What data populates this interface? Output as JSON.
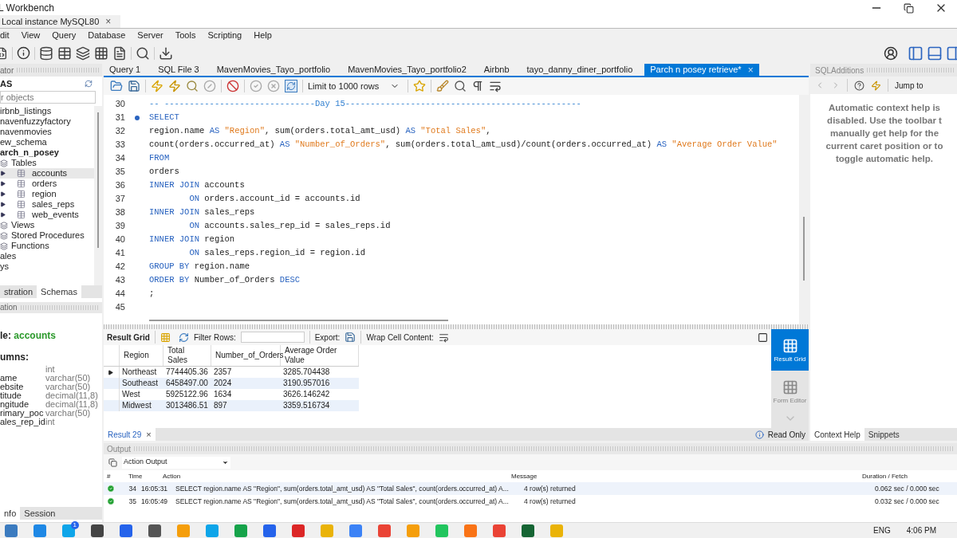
{
  "window": {
    "title": "L Workbench"
  },
  "connection_tab": {
    "label": "Local instance MySQL80",
    "close": "×"
  },
  "menu": [
    "dit",
    "View",
    "Query",
    "Database",
    "Server",
    "Tools",
    "Scripting",
    "Help"
  ],
  "navigator": {
    "header": "ator",
    "schemas_label": "AS",
    "search": {
      "placeholder": "r objects"
    },
    "schemas": [
      {
        "label": "irbnb_listings",
        "active": false
      },
      {
        "label": "navenfuzzyfactory",
        "active": false
      },
      {
        "label": "navenmovies",
        "active": false
      },
      {
        "label": "ew_schema",
        "active": false
      },
      {
        "label": "arch_n_posey",
        "active": true,
        "children": [
          {
            "label": "Tables",
            "children": [
              {
                "label": "accounts",
                "selected": true
              },
              {
                "label": "orders",
                "selected": false
              },
              {
                "label": "region",
                "selected": false
              },
              {
                "label": "sales_reps",
                "selected": false
              },
              {
                "label": "web_events",
                "selected": false
              }
            ]
          },
          {
            "label": "Views"
          },
          {
            "label": "Stored Procedures"
          },
          {
            "label": "Functions"
          }
        ]
      },
      {
        "label": "ales",
        "active": false
      },
      {
        "label": "ys",
        "active": false
      }
    ],
    "tabs": [
      {
        "label": "stration",
        "selected": false
      },
      {
        "label": "Schemas",
        "selected": true
      }
    ]
  },
  "information": {
    "header": "ation",
    "title_prefix": "le: ",
    "title_value": "accounts",
    "columns_label": "umns:",
    "columns": [
      {
        "type": "int"
      },
      {
        "name": "ame",
        "type": "varchar(50)"
      },
      {
        "name": "ebsite",
        "type": "varchar(50)"
      },
      {
        "name": "titude",
        "type": "decimal(11,8)"
      },
      {
        "name": "ngitude",
        "type": "decimal(11,8)"
      },
      {
        "name": "rimary_poc",
        "type": "varchar(50)"
      },
      {
        "name": "ales_rep_id",
        "type": "int"
      }
    ],
    "tabs": [
      {
        "label": "nfo",
        "selected": true
      },
      {
        "label": "Session",
        "selected": false
      }
    ]
  },
  "query_tabs": [
    {
      "label": "Query 1",
      "selected": false
    },
    {
      "label": "SQL File 3",
      "selected": false
    },
    {
      "label": "MavenMovies_Tayo_portfolio",
      "selected": false
    },
    {
      "label": "MavenMovies_Tayo_portfolio2",
      "selected": false
    },
    {
      "label": "Airbnb",
      "selected": false
    },
    {
      "label": "tayo_danny_diner_portfolio",
      "selected": false
    },
    {
      "label": "Parch n posey retrieve*",
      "selected": true,
      "close": "×"
    }
  ],
  "editor": {
    "limit": "Limit to 1000 rows",
    "lines": [
      {
        "number": "30",
        "current": false,
        "segments": [
          {
            "kind": "comment",
            "text": "-- ------------------------------Day 15-----------------------------------------------"
          }
        ]
      },
      {
        "number": "31",
        "current": true,
        "segments": [
          {
            "kind": "keyword",
            "text": "SELECT"
          }
        ]
      },
      {
        "number": "32",
        "current": false,
        "segments": [
          {
            "kind": "plain",
            "text": "region.name "
          },
          {
            "kind": "keyword",
            "text": "AS"
          },
          {
            "kind": "string",
            "text": " \"Region\""
          },
          {
            "kind": "plain",
            "text": ", sum(orders.total_amt_usd) "
          },
          {
            "kind": "keyword",
            "text": "AS"
          },
          {
            "kind": "string",
            "text": " \"Total Sales\""
          },
          {
            "kind": "plain",
            "text": ","
          }
        ]
      },
      {
        "number": "33",
        "current": false,
        "segments": [
          {
            "kind": "plain",
            "text": "count(orders.occurred_at) "
          },
          {
            "kind": "keyword",
            "text": "AS"
          },
          {
            "kind": "string",
            "text": " \"Number_of_Orders\""
          },
          {
            "kind": "plain",
            "text": ", sum(orders.total_amt_usd)/count(orders.occurred_at) "
          },
          {
            "kind": "keyword",
            "text": "AS"
          },
          {
            "kind": "string",
            "text": " \"Average Order Value\""
          }
        ]
      },
      {
        "number": "34",
        "current": false,
        "segments": [
          {
            "kind": "keyword",
            "text": "FROM"
          }
        ]
      },
      {
        "number": "35",
        "current": false,
        "segments": [
          {
            "kind": "plain",
            "text": "orders"
          }
        ]
      },
      {
        "number": "36",
        "current": false,
        "segments": [
          {
            "kind": "keyword",
            "text": "INNER JOIN"
          },
          {
            "kind": "plain",
            "text": " accounts"
          }
        ]
      },
      {
        "number": "37",
        "current": false,
        "segments": [
          {
            "kind": "keyword",
            "text": "        ON"
          },
          {
            "kind": "plain",
            "text": " orders.account_id = accounts.id"
          }
        ]
      },
      {
        "number": "38",
        "current": false,
        "segments": [
          {
            "kind": "keyword",
            "text": "INNER JOIN"
          },
          {
            "kind": "plain",
            "text": " sales_reps"
          }
        ]
      },
      {
        "number": "39",
        "current": false,
        "segments": [
          {
            "kind": "keyword",
            "text": "        ON"
          },
          {
            "kind": "plain",
            "text": " accounts.sales_rep_id = sales_reps.id"
          }
        ]
      },
      {
        "number": "40",
        "current": false,
        "segments": [
          {
            "kind": "keyword",
            "text": "INNER JOIN"
          },
          {
            "kind": "plain",
            "text": " region"
          }
        ]
      },
      {
        "number": "41",
        "current": false,
        "segments": [
          {
            "kind": "keyword",
            "text": "        ON"
          },
          {
            "kind": "plain",
            "text": " sales_reps.region_id = region.id"
          }
        ]
      },
      {
        "number": "42",
        "current": false,
        "segments": [
          {
            "kind": "keyword",
            "text": "GROUP BY"
          },
          {
            "kind": "plain",
            "text": " region.name"
          }
        ]
      },
      {
        "number": "43",
        "current": false,
        "segments": [
          {
            "kind": "keyword",
            "text": "ORDER BY"
          },
          {
            "kind": "plain",
            "text": " Number_of_Orders "
          },
          {
            "kind": "keyword",
            "text": "DESC"
          }
        ]
      },
      {
        "number": "44",
        "current": false,
        "segments": [
          {
            "kind": "plain",
            "text": ";"
          }
        ]
      },
      {
        "number": "45",
        "current": false
      }
    ]
  },
  "results": {
    "toolbar": {
      "result_grid": "Result Grid",
      "filter": "Filter Rows:",
      "export": "Export:",
      "wrap": "Wrap Cell Content:"
    },
    "columns": [
      "Region",
      "Total Sales",
      "Number_of_Orders",
      "Average Order Value"
    ],
    "rows": [
      {
        "current": true,
        "cells": [
          "Northeast",
          "7744405.36",
          "2357",
          "3285.704438"
        ]
      },
      {
        "current": false,
        "cells": [
          "Southeast",
          "6458497.00",
          "2024",
          "3190.957016"
        ]
      },
      {
        "current": false,
        "cells": [
          "West",
          "5925122.96",
          "1634",
          "3626.146242"
        ]
      },
      {
        "current": false,
        "cells": [
          "Midwest",
          "3013486.51",
          "897",
          "3359.516734"
        ]
      }
    ],
    "side_panel": [
      {
        "label": "Result Grid",
        "selected": true
      },
      {
        "label": "Form Editor",
        "selected": false
      }
    ],
    "tab": {
      "label": "Result 29",
      "close": "×"
    },
    "status": "Read Only"
  },
  "output": {
    "header": "Output",
    "selector": "Action Output",
    "columns": [
      "#",
      "Time",
      "Action",
      "Message",
      "Duration / Fetch"
    ],
    "rows": [
      {
        "succeeded": true,
        "number": "34",
        "time": "16:05:31",
        "action": "SELECT  region.name AS \"Region\", sum(orders.total_amt_usd) AS \"Total Sales\", count(orders.occurred_at) A...",
        "message": "4 row(s) returned",
        "duration": "0.062 sec / 0.000 sec"
      },
      {
        "succeeded": true,
        "number": "35",
        "time": "16:05:49",
        "action": "SELECT  region.name AS \"Region\", sum(orders.total_amt_usd) AS \"Total Sales\", count(orders.occurred_at) A...",
        "message": "4 row(s) returned",
        "duration": "0.032 sec / 0.000 sec"
      }
    ]
  },
  "sql_additions": {
    "header": "SQLAdditions",
    "jump": "Jump to",
    "help_lines": [
      "Automatic context help is",
      "disabled. Use the toolbar t",
      "manually get help for the",
      "current caret position or to",
      "toggle automatic help."
    ],
    "tabs": [
      {
        "label": "Context Help",
        "selected": true
      },
      {
        "label": "Snippets",
        "selected": false
      }
    ]
  },
  "taskbar": {
    "badge": "1",
    "language": "ENG",
    "time": "4:06 PM"
  }
}
